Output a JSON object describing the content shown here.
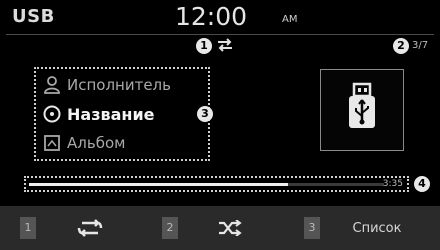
{
  "status_bar": {
    "source": "USB",
    "time": "12:00",
    "ampm": "AM"
  },
  "markers": [
    "1",
    "2",
    "3",
    "4"
  ],
  "track_count": "3/7",
  "metadata": {
    "artist": "Исполнитель",
    "title": "Название",
    "album": "Альбом"
  },
  "progress": {
    "fraction": 0.73,
    "time": "3:35"
  },
  "softkeys": [
    {
      "number": "1",
      "icon": "repeat-icon"
    },
    {
      "number": "2",
      "icon": "shuffle-icon"
    },
    {
      "number": "3",
      "label": "Список"
    }
  ],
  "colors": {
    "background": "#000000",
    "text": "#d8d8d8",
    "bottom_bar": "#2a2a2a"
  }
}
